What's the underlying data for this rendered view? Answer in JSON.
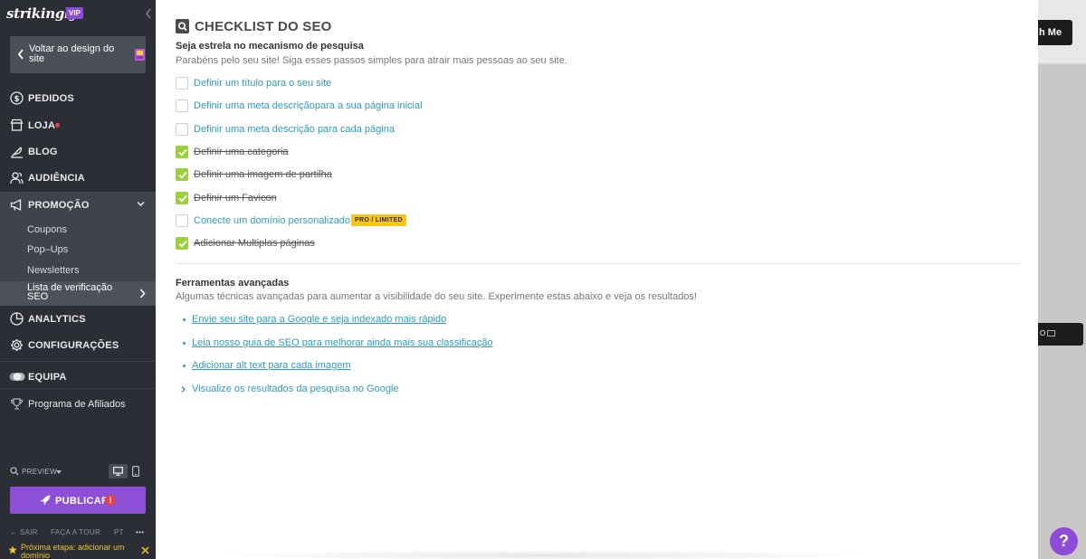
{
  "brand": {
    "logo": "strikingly",
    "badge": "VIP"
  },
  "sidebar": {
    "back_label": "Voltar ao design do site",
    "nav": {
      "pedidos": "PEDIDOS",
      "loja": "LOJA",
      "blog": "BLOG",
      "audiencia": "AUDIÊNCIA",
      "promocao": "PROMOÇÃO",
      "analytics": "ANALYTICS",
      "configuracoes": "CONFIGURAÇÕES",
      "equipa": "EQUIPA",
      "afiliados": "Programa de Afiliados"
    },
    "submenu": [
      "Coupons",
      "Pop–Ups",
      "Newsletters",
      "Lista de verificação SEO"
    ],
    "preview_label": "PREVIEW",
    "publish_label": "PUBLICAR",
    "publish_warning": "!",
    "footer": {
      "sair": "SAIR",
      "tour": "FAÇA A TOUR",
      "lang": "PT",
      "more": "•••"
    },
    "next_step": "Próxima etapa: adicionar um domínio"
  },
  "background": {
    "btn1": "h Me",
    "btn2": "O",
    "help": "?"
  },
  "seo": {
    "title": "CHECKLIST DO SEO",
    "heading": "Seja estrela no mecanismo de pesquisa",
    "intro": "Parabéns pelo seu site! Siga esses passos simples para atrair mais pessoas ao seu site.",
    "checklist": [
      {
        "label": "Definir um título para o seu site",
        "done": false
      },
      {
        "label": "Definir uma meta descriçãopara a sua página inicial",
        "done": false
      },
      {
        "label": "Definir uma meta descrição para cada página",
        "done": false
      },
      {
        "label": "Definir uma categoria",
        "done": true
      },
      {
        "label": "Definir uma imagem de partilha",
        "done": true
      },
      {
        "label": "Definir um Favicon",
        "done": true
      },
      {
        "label": "Conecte um domínio personalizado",
        "done": false,
        "badge": "PRO / LIMITED"
      },
      {
        "label": "Adicionar Multiplas páginas",
        "done": true
      }
    ],
    "advanced_heading": "Ferramentas avançadas",
    "advanced_intro": "Algumas técnicas avançadas para aumentar a visibilidade do seu site. Experimente estas abaixo e veja os resultados!",
    "links": [
      "Envie seu site para a Google e seja indexado mais rápido",
      "Leia nosso guia de SEO para melhorar ainda mais sua classificação",
      "Adicionar alt text para cada imagem"
    ],
    "expand_label": "Visualize os resultados da pesquisa no Google"
  },
  "colors": {
    "accent": "#8d4fd6",
    "link": "#2d9bc2",
    "check": "#9bcf3d",
    "badge": "#f5c518"
  }
}
